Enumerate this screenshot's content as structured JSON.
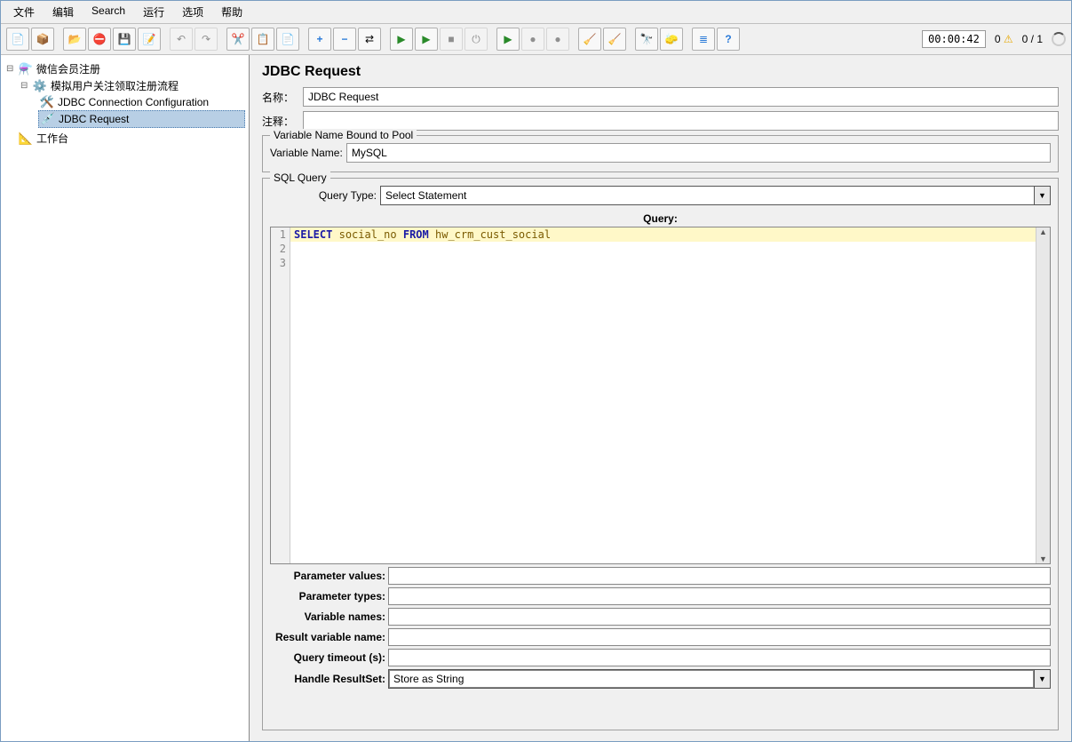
{
  "menu": {
    "file": "文件",
    "edit": "编辑",
    "search": "Search",
    "run": "运行",
    "options": "选项",
    "help": "帮助"
  },
  "status": {
    "timer": "00:00:42",
    "warn_count": "0",
    "progress": "0 / 1"
  },
  "tree": {
    "root": "微信会员注册",
    "thread": "模拟用户关注领取注册流程",
    "jdbc_conn": "JDBC Connection Configuration",
    "jdbc_req": "JDBC Request",
    "workbench": "工作台"
  },
  "page": {
    "title": "JDBC Request",
    "name_label": "名称：",
    "name_value": "JDBC Request",
    "comment_label": "注释：",
    "comment_value": ""
  },
  "var_pool": {
    "legend": "Variable Name Bound to Pool",
    "label": "Variable Name:",
    "value": "MySQL"
  },
  "sql": {
    "legend": "SQL Query",
    "query_type_label": "Query Type:",
    "query_type_value": "Select Statement",
    "query_header": "Query:",
    "line1_kw1": "SELECT",
    "line1_id1": "social_no",
    "line1_kw2": "FROM",
    "line1_id2": "hw_crm_cust_social",
    "gutter": [
      "1",
      "2",
      "3"
    ]
  },
  "params": {
    "param_values_label": "Parameter values:",
    "param_values": "",
    "param_types_label": "Parameter types:",
    "param_types": "",
    "var_names_label": "Variable names:",
    "var_names": "",
    "result_var_label": "Result variable name:",
    "result_var": "",
    "timeout_label": "Query timeout (s):",
    "timeout": "",
    "handle_rs_label": "Handle ResultSet:",
    "handle_rs_value": "Store as String"
  }
}
